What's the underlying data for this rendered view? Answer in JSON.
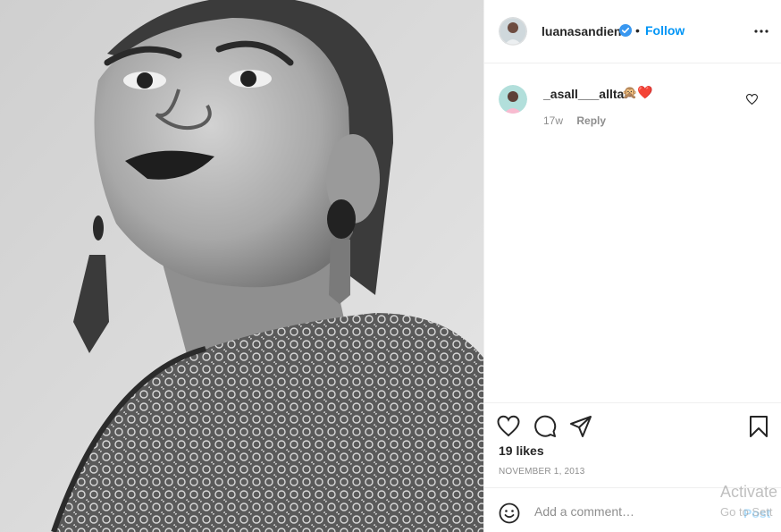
{
  "post": {
    "image_alt": "Black and white portrait of a woman with slicked-back hair, dark lipstick, drop earrings and a lace top",
    "author": {
      "username": "luanasandien",
      "verified": true,
      "separator": "•",
      "follow_label": "Follow"
    },
    "more_icon": "more-options-icon"
  },
  "comments": [
    {
      "username": "_asall___alltaf",
      "text": "🙊❤️",
      "age": "17w",
      "reply_label": "Reply"
    }
  ],
  "actions": {
    "icons": [
      "heart-icon",
      "comment-icon",
      "share-icon",
      "bookmark-icon"
    ],
    "likes_label": "19 likes",
    "date": "NOVEMBER 1, 2013"
  },
  "add_comment": {
    "placeholder": "Add a comment…",
    "post_label": "Post"
  },
  "os_watermark": {
    "line1": "Activate",
    "line2": "Go to Sett"
  },
  "colors": {
    "accent": "#0095f6",
    "verified_badge": "#3897f0",
    "muted": "#8e8e8e",
    "post_disabled": "#b2dffc",
    "heart_red": "#ed4956"
  }
}
